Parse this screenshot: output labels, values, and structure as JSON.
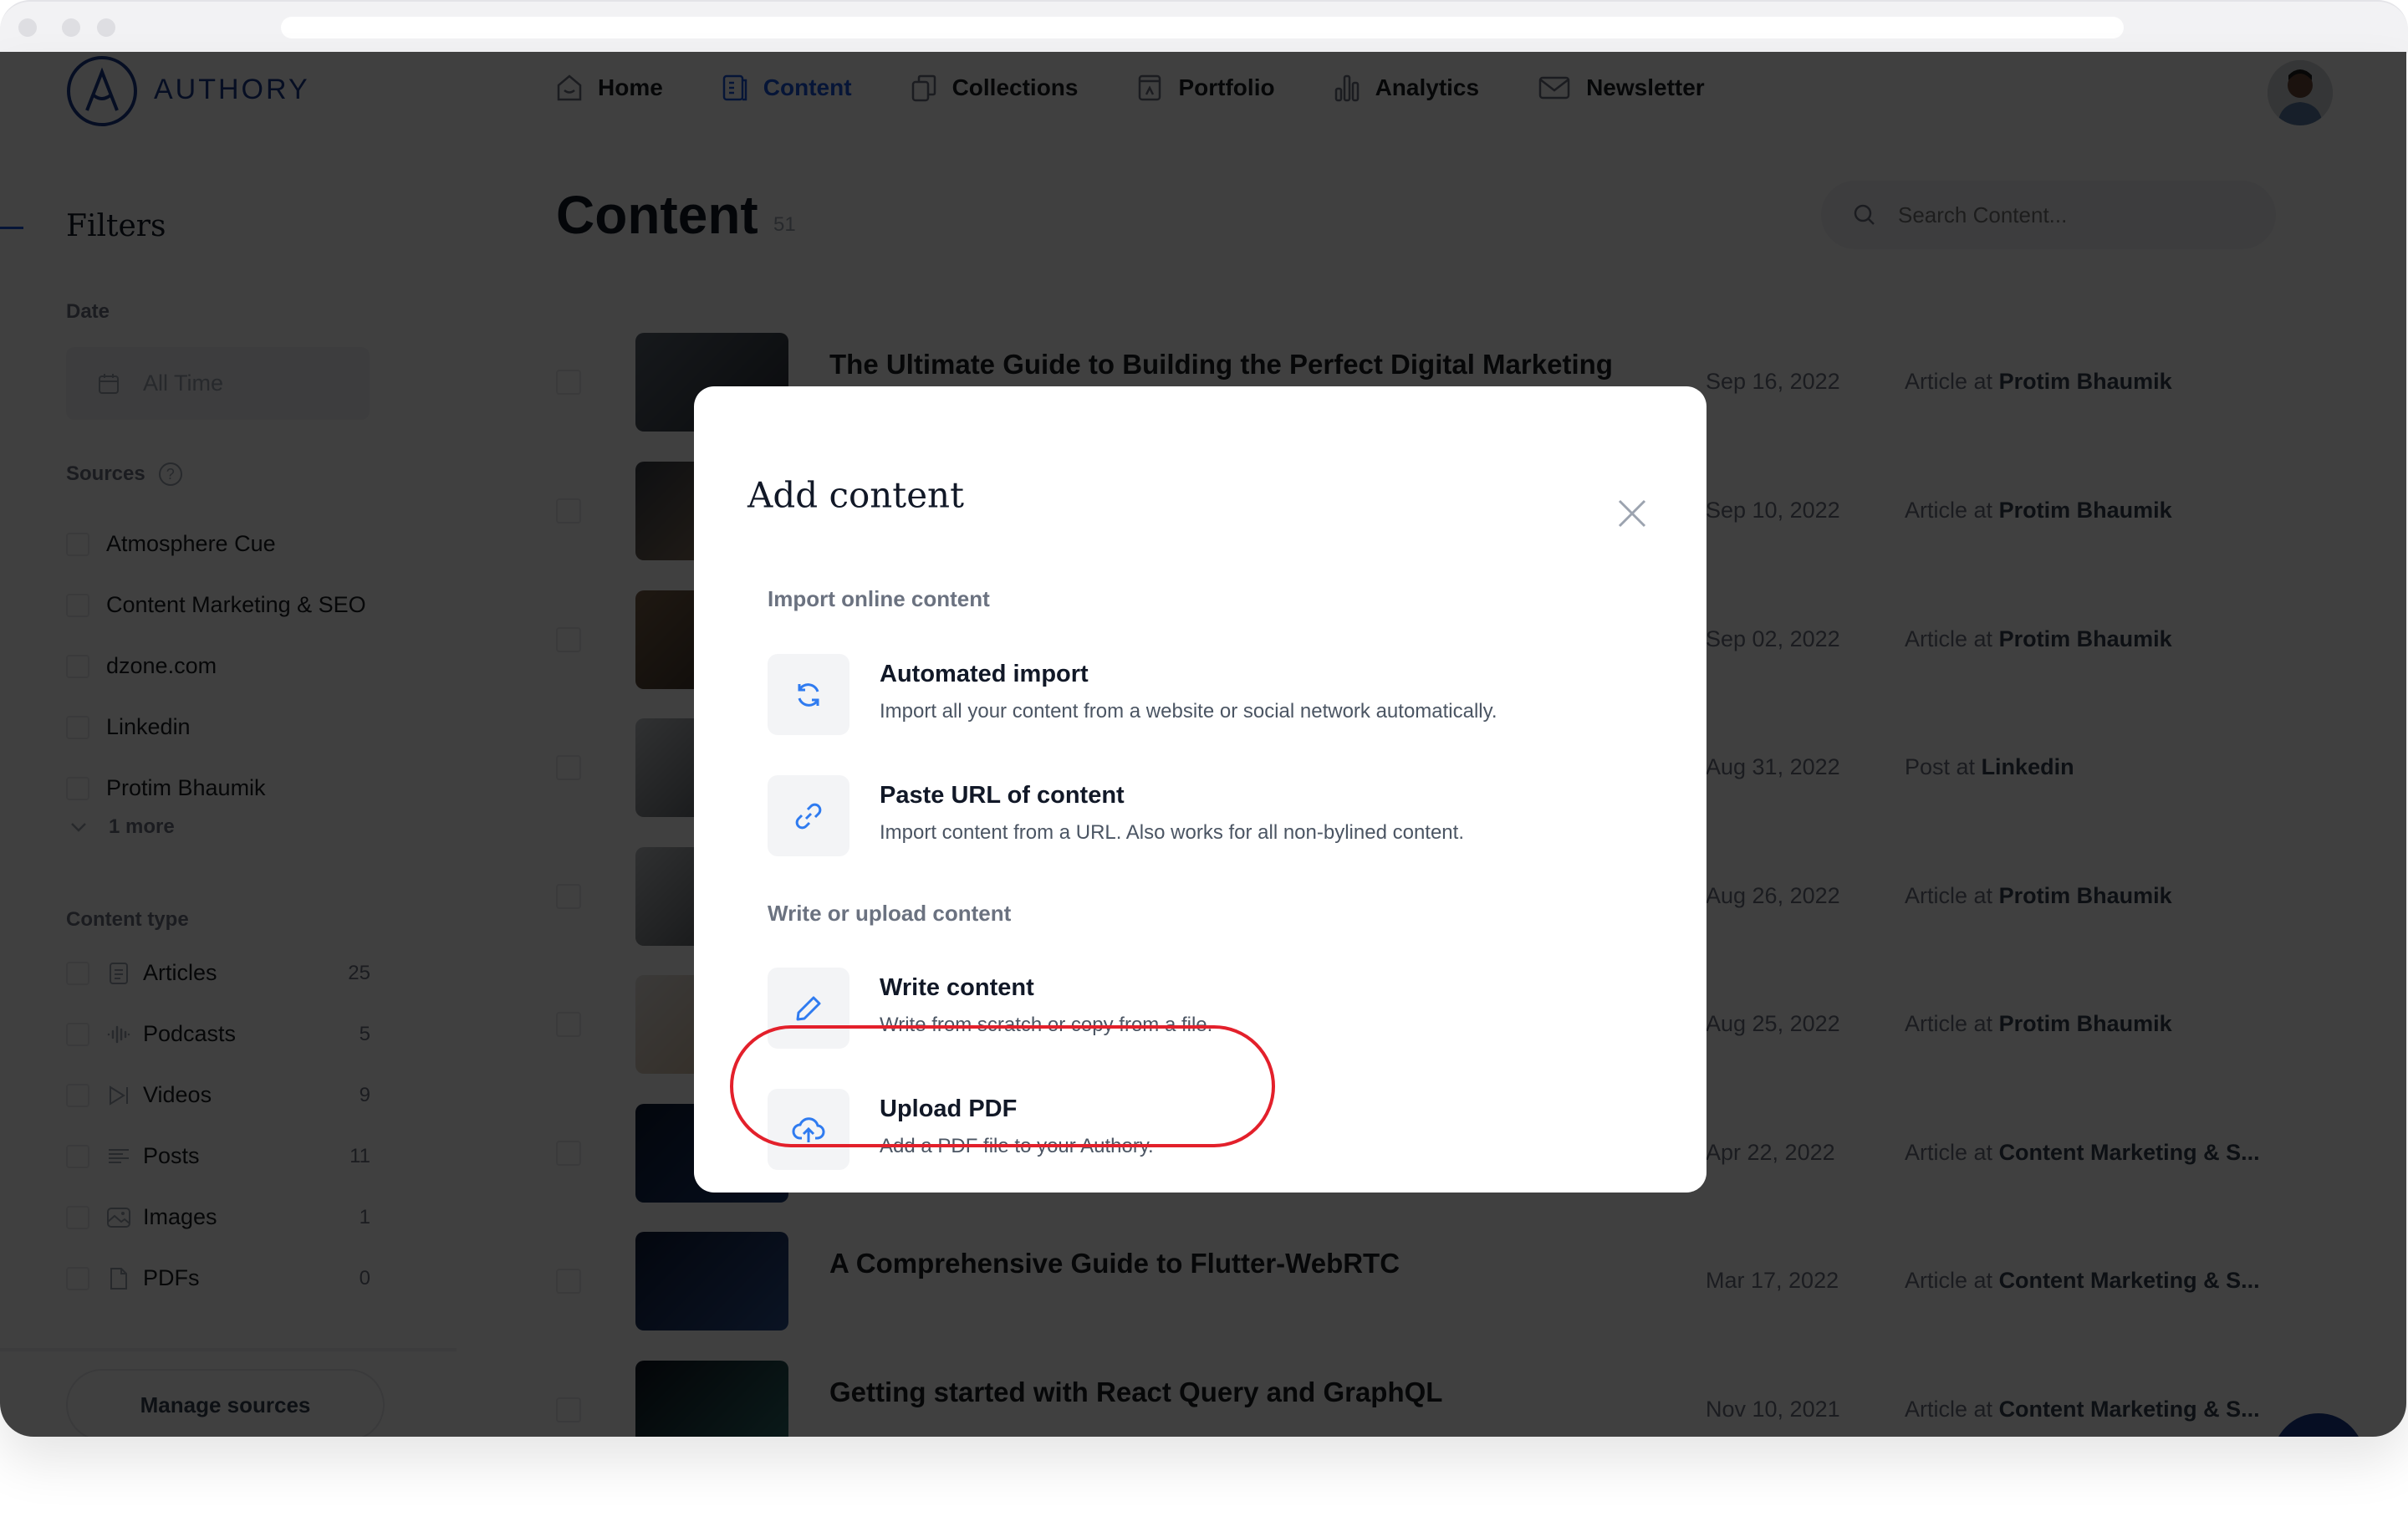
{
  "colors": {
    "brand": "#1a3a8a",
    "accent": "#1a56db",
    "icon_blue": "#2f7bf0",
    "highlight": "#e3202b",
    "overlay": "rgba(0,0,0,0.75)"
  },
  "brand": {
    "name": "AUTHORY",
    "logo_icon": "authory-logo-icon"
  },
  "nav": {
    "items": [
      {
        "label": "Home",
        "icon": "home-icon",
        "active": false
      },
      {
        "label": "Content",
        "icon": "document-icon",
        "active": true
      },
      {
        "label": "Collections",
        "icon": "collections-icon",
        "active": false
      },
      {
        "label": "Portfolio",
        "icon": "portfolio-icon",
        "active": false
      },
      {
        "label": "Analytics",
        "icon": "bar-chart-icon",
        "active": false
      },
      {
        "label": "Newsletter",
        "icon": "mail-icon",
        "active": false
      }
    ],
    "avatar": "user-avatar"
  },
  "sidebar": {
    "title": "Filters",
    "date": {
      "label": "Date",
      "value": "All Time"
    },
    "sources": {
      "label": "Sources",
      "items": [
        "Atmosphere Cue",
        "Content Marketing & SEO",
        "dzone.com",
        "Linkedin",
        "Protim Bhaumik"
      ],
      "more": "1 more"
    },
    "content_type": {
      "label": "Content type",
      "items": [
        {
          "label": "Articles",
          "count": "25",
          "icon": "article-icon"
        },
        {
          "label": "Podcasts",
          "count": "5",
          "icon": "audio-wave-icon"
        },
        {
          "label": "Videos",
          "count": "9",
          "icon": "video-icon"
        },
        {
          "label": "Posts",
          "count": "11",
          "icon": "text-lines-icon"
        },
        {
          "label": "Images",
          "count": "1",
          "icon": "image-icon"
        },
        {
          "label": "PDFs",
          "count": "0",
          "icon": "file-icon"
        }
      ]
    },
    "manage_sources": "Manage sources"
  },
  "main": {
    "title": "Content",
    "count": "51",
    "search_placeholder": "Search Content...",
    "rows": [
      {
        "title": "The Ultimate Guide to Building the Perfect Digital Marketing",
        "date": "Sep 16, 2022",
        "type": "Article at",
        "source": "Protim Bhaumik"
      },
      {
        "title": "",
        "date": "Sep 10, 2022",
        "type": "Article at",
        "source": "Protim Bhaumik"
      },
      {
        "title": "",
        "date": "Sep 02, 2022",
        "type": "Article at",
        "source": "Protim Bhaumik"
      },
      {
        "title": "",
        "date": "Aug 31, 2022",
        "type": "Post at",
        "source": "Linkedin"
      },
      {
        "title": "",
        "date": "Aug 26, 2022",
        "type": "Article at",
        "source": "Protim Bhaumik"
      },
      {
        "title": "",
        "date": "Aug 25, 2022",
        "type": "Article at",
        "source": "Protim Bhaumik"
      },
      {
        "title": "",
        "date": "Apr 22, 2022",
        "type": "Article at",
        "source": "Content Marketing & S..."
      },
      {
        "title": "A Comprehensive Guide to Flutter-WebRTC",
        "date": "Mar 17, 2022",
        "type": "Article at",
        "source": "Content Marketing & S..."
      },
      {
        "title": "Getting started with React Query and GraphQL",
        "date": "Nov 10, 2021",
        "type": "Article at",
        "source": "Content Marketing & S..."
      }
    ]
  },
  "modal": {
    "title": "Add content",
    "close_icon": "close-icon",
    "sections": [
      {
        "label": "Import online content",
        "options": [
          {
            "title": "Automated import",
            "description": "Import all your content from a website or social network automatically.",
            "icon": "sync-icon"
          },
          {
            "title": "Paste URL of content",
            "description": "Import content from a URL. Also works for all non-bylined content.",
            "icon": "link-icon"
          }
        ]
      },
      {
        "label": "Write or upload content",
        "options": [
          {
            "title": "Write content",
            "description": "Write from scratch or copy from a file.",
            "icon": "pencil-icon"
          },
          {
            "title": "Upload PDF",
            "description": "Add a PDF file to your Authory.",
            "icon": "cloud-upload-icon",
            "highlighted": true
          }
        ]
      }
    ]
  }
}
